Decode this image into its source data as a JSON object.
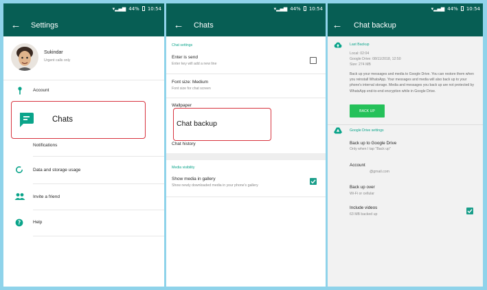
{
  "status": {
    "signal": "• ••• ",
    "battery": "44%",
    "time": "10:54"
  },
  "settings": {
    "title": "Settings",
    "profile": {
      "name": "Sukindar",
      "status": "Urgent calls only"
    },
    "items": [
      {
        "label": "Account",
        "icon": "key-icon"
      },
      {
        "label": "Chats",
        "icon": "chat-icon"
      },
      {
        "label": "Notifications",
        "icon": "bell-icon"
      },
      {
        "label": "Data and storage usage",
        "icon": "data-usage-icon"
      },
      {
        "label": "Invite a friend",
        "icon": "people-icon"
      },
      {
        "label": "Help",
        "icon": "help-icon"
      }
    ],
    "callout": "Chats"
  },
  "chats": {
    "title": "Chats",
    "section_chat_settings": "Chat settings",
    "enter_is_send": {
      "title": "Enter is send",
      "subtitle": "Enter key will add a new line",
      "checked": false
    },
    "font_size": {
      "title": "Font size: Medium",
      "subtitle": "Font size for chat screen"
    },
    "wallpaper": "Wallpaper",
    "callout": "Chat backup",
    "chat_history": "Chat history",
    "section_media": "Media visibility",
    "show_media": {
      "title": "Show media in gallery",
      "subtitle": "Show newly downloaded media in your phone's gallery",
      "checked": true
    }
  },
  "backup": {
    "title": "Chat backup",
    "last_backup_heading": "Last Backup",
    "local": "Local: 02:04",
    "gdrive": "Google Drive: 08/11/2018, 12:50",
    "size": "Size: 274 MB",
    "description": "Back up your messages and media to Google Drive. You can restore them when you reinstall WhatsApp. Your messages and media will also back up to your phone's internal storage. Media and messages you back up are not protected by WhatsApp end-to-end encryption while in Google Drive.",
    "button": "BACK UP",
    "gdrive_heading": "Google Drive settings",
    "backup_to_drive": {
      "title": "Back up to Google Drive",
      "subtitle": "Only when I tap \"Back up\""
    },
    "account": {
      "title": "Account",
      "subtitle": "@gmail.com"
    },
    "backup_over": {
      "title": "Back up over",
      "subtitle": "Wi-Fi or cellular"
    },
    "include_videos": {
      "title": "Include videos",
      "subtitle": "63 MB backed up",
      "checked": true
    }
  },
  "colors": {
    "header": "#075e54",
    "accent": "#0aa48a",
    "callout_border": "#d7323d",
    "button": "#25c15a"
  }
}
